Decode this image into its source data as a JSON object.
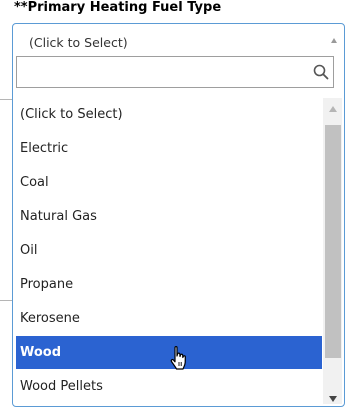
{
  "field": {
    "label": "**Primary Heating Fuel Type",
    "selected_value": "(Click to Select)"
  },
  "search": {
    "value": "",
    "placeholder": "",
    "icon": "search-icon"
  },
  "options": [
    {
      "label": "(Click to Select)",
      "selected": false
    },
    {
      "label": "Electric",
      "selected": false
    },
    {
      "label": "Coal",
      "selected": false
    },
    {
      "label": "Natural Gas",
      "selected": false
    },
    {
      "label": "Oil",
      "selected": false
    },
    {
      "label": "Propane",
      "selected": false
    },
    {
      "label": "Kerosene",
      "selected": false
    },
    {
      "label": "Wood",
      "selected": true
    },
    {
      "label": "Wood Pellets",
      "selected": false
    }
  ],
  "colors": {
    "highlight": "#2b63d1",
    "frame_border": "#5b9bd5"
  }
}
